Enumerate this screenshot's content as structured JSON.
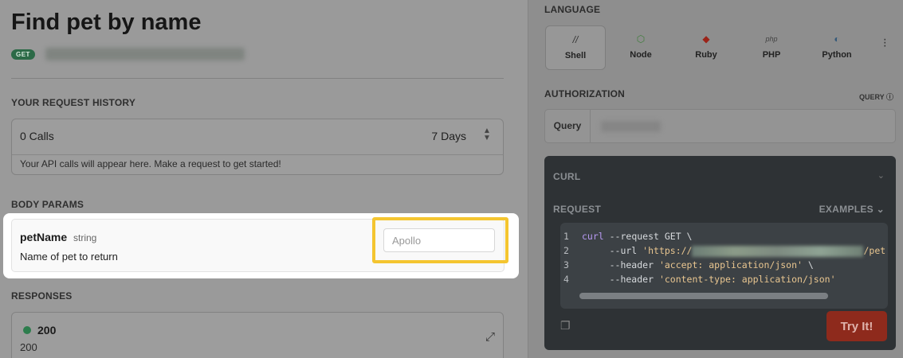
{
  "endpoint": {
    "title": "Find pet by name",
    "method": "GET"
  },
  "history": {
    "section_label": "YOUR REQUEST HISTORY",
    "calls": "0 Calls",
    "range": "7 Days",
    "hint": "Your API calls will appear here. Make a request to get started!"
  },
  "body_params": {
    "section_label": "BODY PARAMS",
    "param": {
      "name": "petName",
      "type": "string",
      "description": "Name of pet to return",
      "placeholder": "Apollo"
    }
  },
  "responses": {
    "section_label": "RESPONSES",
    "code": "200",
    "subtitle": "200",
    "status_color": "#2d7d4d"
  },
  "language": {
    "section_label": "LANGUAGE",
    "items": [
      {
        "label": "Shell",
        "icon": "shell-icon",
        "active": true
      },
      {
        "label": "Node",
        "icon": "node-icon"
      },
      {
        "label": "Ruby",
        "icon": "ruby-icon"
      },
      {
        "label": "PHP",
        "icon": "php-icon"
      },
      {
        "label": "Python",
        "icon": "python-icon"
      }
    ]
  },
  "authorization": {
    "section_label": "AUTHORIZATION",
    "query_tag": "QUERY",
    "field_label": "Query"
  },
  "code_panel": {
    "curl_label": "CURL",
    "request_label": "REQUEST",
    "examples_label": "EXAMPLES",
    "try_label": "Try It!",
    "lines": [
      {
        "n": "1",
        "cmd": "curl",
        "rest": " --request GET \\"
      },
      {
        "n": "2",
        "pre": "     --url ",
        "str_start": "'https://",
        "str_end": "/pet"
      },
      {
        "n": "3",
        "pre": "     --header ",
        "str": "'accept: application/json'",
        "post": " \\"
      },
      {
        "n": "4",
        "pre": "     --header ",
        "str": "'content-type: application/json'"
      }
    ]
  },
  "colors": {
    "highlight": "#f4c530",
    "try_button": "#8e2a1c",
    "method_badge": "#2c6a47"
  }
}
